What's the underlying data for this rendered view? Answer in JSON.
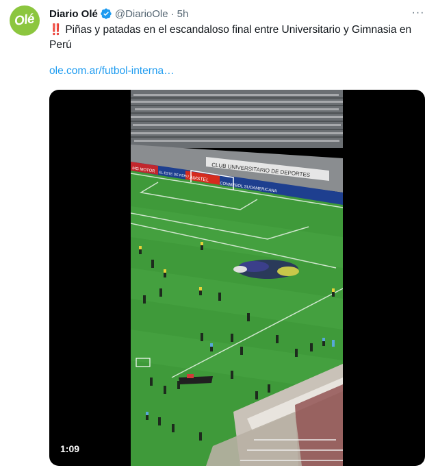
{
  "tweet": {
    "display_name": "Diario Olé",
    "handle": "@DiarioOle",
    "separator": "·",
    "time": "5h",
    "more_label": "···",
    "avatar_text": "Olé",
    "alert_emoji": "‼️",
    "text": "Piñas y patadas en el escandaloso final entre Universitario y Gimnasia en Perú",
    "link": "ole.com.ar/futbol-interna…",
    "verified_icon": "verified-badge-icon",
    "colors": {
      "link": "#1d9bf0",
      "verified": "#1d9bf0",
      "avatar": "#8cc63f",
      "muted": "#536471"
    }
  },
  "video": {
    "duration": "1:09",
    "ad_boards": [
      "MG MOTOR",
      "EL ESTE DE PERU",
      "AMSTEL",
      "CONMEBOL SUDAMERICANA"
    ],
    "stand_banner": "CLUB UNIVERSITARIO DE DEPORTES"
  }
}
